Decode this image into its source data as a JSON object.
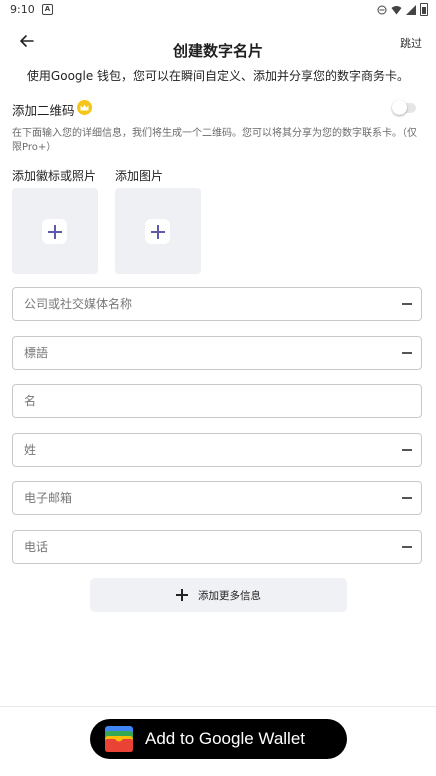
{
  "status": {
    "time": "9:10",
    "notification_glyph": "A"
  },
  "header": {
    "title": "创建数字名片",
    "skip_label": "跳过",
    "subtitle": "使用Google 钱包，您可以在瞬间自定义、添加并分享您的数字商务卡。"
  },
  "qr": {
    "label": "添加二维码",
    "description": "在下面输入您的详细信息，我们将生成一个二维码。您可以将其分享为您的数字联系卡。（仅限Pro+）",
    "enabled": false
  },
  "uploads": {
    "logo_label": "添加徽标或照片",
    "image_label": "添加图片"
  },
  "fields": [
    {
      "placeholder": "公司或社交媒体名称",
      "value": "",
      "removable": true
    },
    {
      "placeholder": "標語",
      "value": "",
      "removable": true
    },
    {
      "placeholder": "名",
      "value": "",
      "removable": false
    },
    {
      "placeholder": "姓",
      "value": "",
      "removable": true
    },
    {
      "placeholder": "电子邮箱",
      "value": "",
      "removable": true
    },
    {
      "placeholder": "电话",
      "value": "",
      "removable": true
    }
  ],
  "actions": {
    "add_more_label": "添加更多信息",
    "wallet_label": "Add to Google Wallet"
  },
  "colors": {
    "accent_plus": "#5e5aa9",
    "upload_bg": "#eef0f4",
    "crown": "#f5c518",
    "wallet_bg": "#000000"
  },
  "icons": {
    "back": "arrow-left-icon",
    "premium": "crown-icon",
    "upload": "plus-icon",
    "remove": "minus-icon",
    "wallet": "google-wallet-icon"
  }
}
